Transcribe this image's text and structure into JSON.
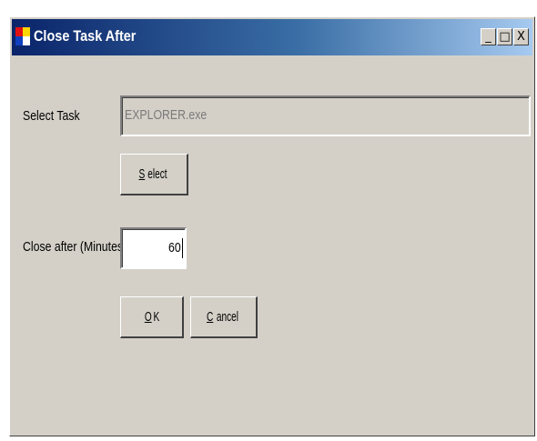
{
  "window": {
    "title": "Close Task After",
    "controls": {
      "minimize": "_",
      "maximize": "□",
      "close": "X"
    }
  },
  "form": {
    "select_task_label": "Select Task",
    "task_value": "EXPLORER.exe",
    "select_button": {
      "mnemonic": "S",
      "rest": "elect"
    },
    "close_after_label": "Close after (Minutes)",
    "minutes_value": "60",
    "ok_button": {
      "mnemonic": "O",
      "rest": "K"
    },
    "cancel_button": {
      "mnemonic": "C",
      "rest": "ancel"
    }
  },
  "icons": {
    "app_icon": "app-window-icon",
    "app_icon_colors": [
      "#ffd700",
      "#e01010",
      "#1040c0",
      "#ffffff"
    ]
  }
}
